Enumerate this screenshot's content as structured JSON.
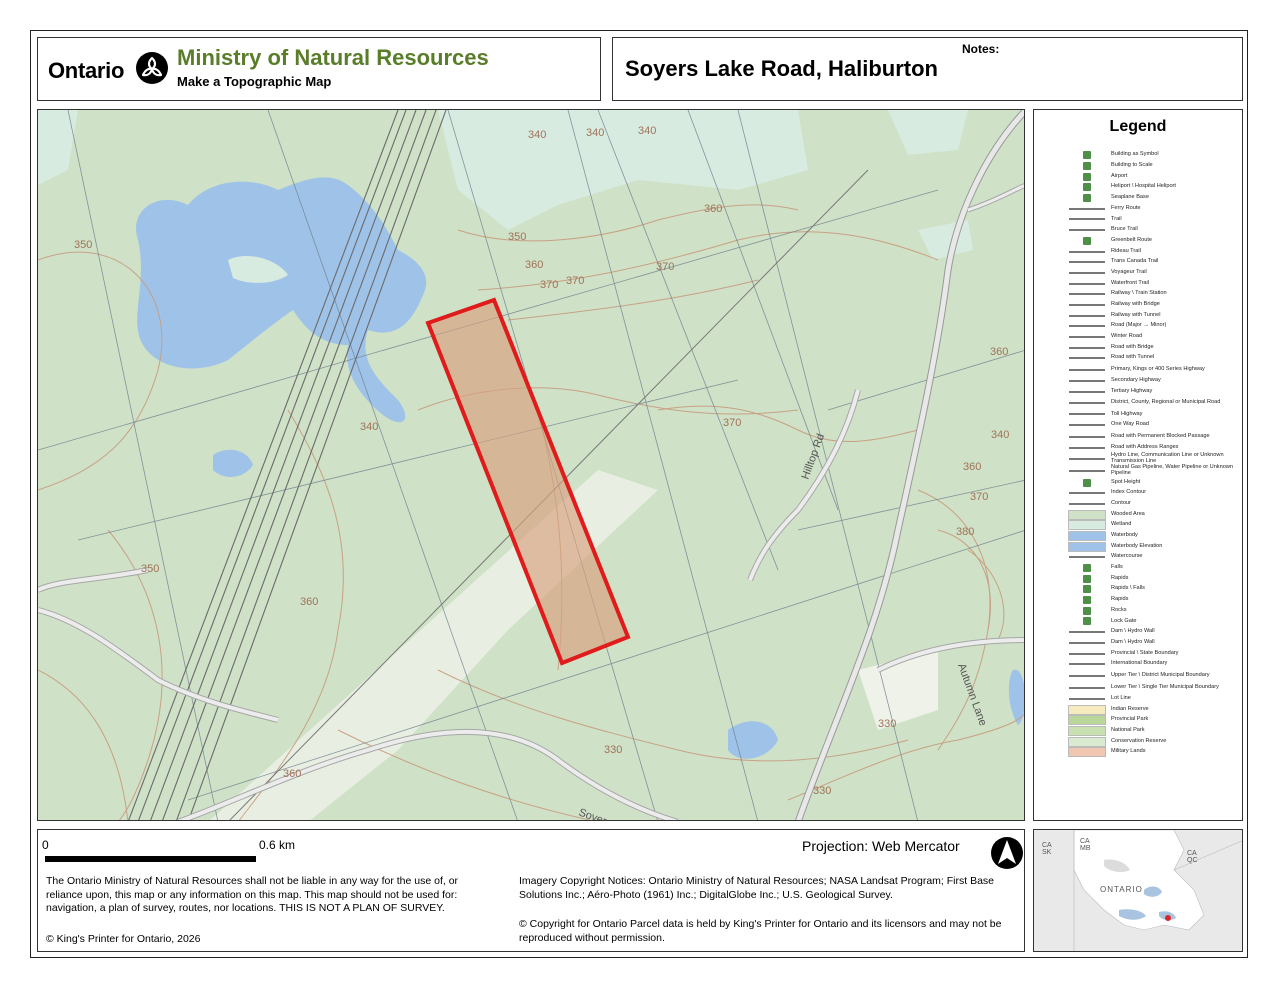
{
  "header": {
    "brand": "Ontario",
    "ministry": "Ministry of Natural Resources",
    "subtitle": "Make a Topographic Map",
    "map_title": "Soyers Lake Road, Haliburton",
    "notes_label": "Notes:"
  },
  "map": {
    "contour_labels": [
      "340",
      "340",
      "340",
      "350",
      "350",
      "360",
      "360",
      "370",
      "370",
      "370",
      "360",
      "370",
      "340",
      "360",
      "370",
      "380",
      "340",
      "350",
      "360",
      "360",
      "330",
      "330",
      "330"
    ],
    "road_labels": [
      "Hilltop Rd",
      "Autumn Lane",
      "Soyers"
    ],
    "colors": {
      "woodland": "#cfe1c6",
      "water": "#9fc3e8",
      "wetland": "#d8ebe0",
      "contour": "#c79b7e",
      "highlight": "#e01b1b"
    }
  },
  "legend": {
    "title": "Legend",
    "items": [
      "Building as Symbol",
      "Building to Scale",
      "Airport",
      "Heliport \\ Hospital Heliport",
      "Seaplane Base",
      "Ferry Route",
      "Trail",
      "Bruce Trail",
      "Greenbelt Route",
      "Rideau Trail",
      "Trans Canada Trail",
      "Voyageur Trail",
      "Waterfront Trail",
      "Railway \\ Train Station",
      "Railway with Bridge",
      "Railway with Tunnel",
      "Road (Major → Minor)",
      "Winter Road",
      "Road with Bridge",
      "Road with Tunnel",
      "Primary, Kings or 400 Series Highway",
      "Secondary Highway",
      "Tertiary Highway",
      "District, County, Regional or Municipal Road",
      "Toll Highway",
      "One Way Road",
      "Road with Permanent Blocked Passage",
      "Road with Address Ranges",
      "Hydro Line, Communication Line or Unknown Transmission Line",
      "Natural Gas Pipeline, Water Pipeline or Unknown Pipeline",
      "Spot Height",
      "Index Contour",
      "Contour",
      "Wooded Area",
      "Wetland",
      "Waterbody",
      "Waterbody Elevation",
      "Watercourse",
      "Falls",
      "Rapids",
      "Rapids \\ Falls",
      "Rapids",
      "Rocks",
      "Lock Gate",
      "Dam \\ Hydro Wall",
      "Dam \\ Hydro Wall",
      "Provincial \\ State Boundary",
      "International Boundary",
      "Upper Tier \\ District Municipal Boundary",
      "Lower Tier \\ Single Tier Municipal Boundary",
      "Lot Line",
      "Indian Reserve",
      "Provincial Park",
      "National Park",
      "Conservation Reserve",
      "Military Lands"
    ]
  },
  "footer": {
    "scale_zero": "0",
    "scale_max": "0.6 km",
    "projection": "Projection: Web Mercator",
    "disclaimer": "The Ontario Ministry of Natural Resources shall not be liable in any way for the use of, or reliance upon, this map or any information on this map.  This map should not be used for: navigation, a plan of survey, routes, nor locations. THIS IS NOT A PLAN OF SURVEY.",
    "copyright": "© King's Printer for Ontario, 2026",
    "imagery": "Imagery Copyright Notices: Ontario Ministry of Natural Resources; NASA Landsat Program; First Base Solutions Inc.; Aéro-Photo (1961) Inc.; DigitalGlobe Inc.; U.S. Geological Survey.",
    "parcel": "© Copyright for Ontario Parcel data is held by King's Printer for Ontario and its licensors and may not be reproduced without permission."
  },
  "inset": {
    "labels": [
      "CA SK",
      "CA MB",
      "CA QC",
      "ONTARIO"
    ],
    "marker_color": "#d9262b"
  }
}
